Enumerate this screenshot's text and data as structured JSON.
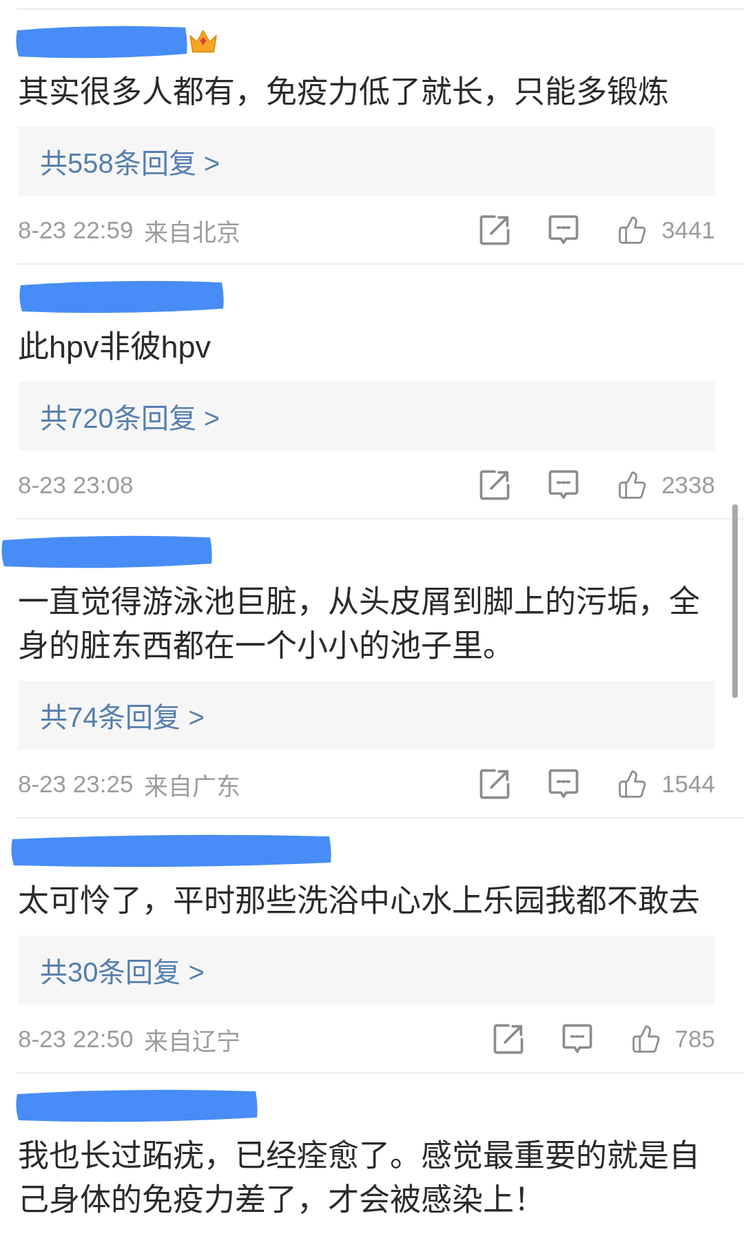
{
  "comments": [
    {
      "name_redacted": true,
      "vip_badge": true,
      "text": "其实很多人都有，免疫力低了就长，只能多锻炼",
      "replies": "共558条回复 >",
      "time": "8-23 22:59",
      "location": "来自北京",
      "likes": "3441"
    },
    {
      "name_redacted": true,
      "text": "此hpv非彼hpv",
      "replies": "共720条回复 >",
      "time": "8-23 23:08",
      "likes": "2338"
    },
    {
      "name_redacted": true,
      "text": "一直觉得游泳池巨脏，从头皮屑到脚上的污垢，全身的脏东西都在一个小小的池子里。",
      "replies": "共74条回复 >",
      "time": "8-23 23:25",
      "location": "来自广东",
      "likes": "1544"
    },
    {
      "name_redacted": true,
      "text": "太可怜了，平时那些洗浴中心水上乐园我都不敢去",
      "replies": "共30条回复 >",
      "time": "8-23 22:50",
      "location": "来自辽宁",
      "likes": "785"
    },
    {
      "name_redacted": true,
      "text": "我也长过跖疣，已经痊愈了。感觉最重要的就是自己身体的免疫力差了，才会被感染上！"
    }
  ]
}
